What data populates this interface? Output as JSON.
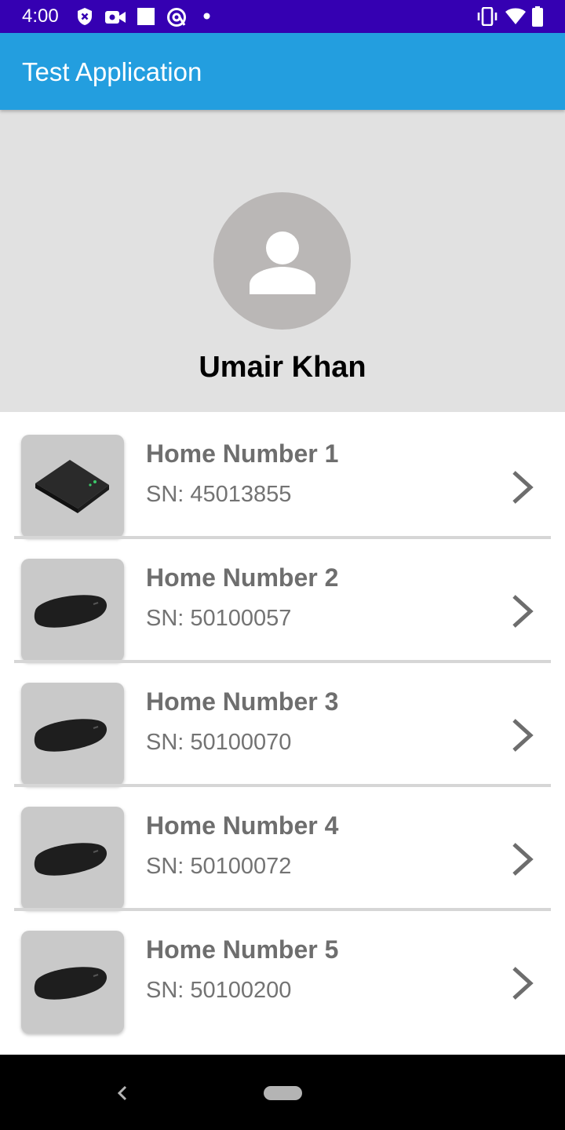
{
  "status_bar": {
    "time": "4:00",
    "left_icons": [
      "shield-icon",
      "camera-icon",
      "square-icon",
      "at-circle-icon",
      "dot-icon"
    ],
    "right_icons": [
      "vibrate-icon",
      "wifi-icon",
      "battery-icon"
    ]
  },
  "app_bar": {
    "title": "Test Application"
  },
  "profile": {
    "name": "Umair Khan",
    "avatar_icon": "person-icon"
  },
  "devices": [
    {
      "name": "Home Number 1",
      "serial": "SN: 45013855"
    },
    {
      "name": "Home Number 2",
      "serial": "SN: 50100057"
    },
    {
      "name": "Home Number 3",
      "serial": "SN: 50100070"
    },
    {
      "name": "Home Number 4",
      "serial": "SN: 50100072"
    },
    {
      "name": "Home Number 5",
      "serial": "SN: 50100200"
    }
  ],
  "colors": {
    "status_bar": "#3500b2",
    "app_bar": "#239edf",
    "profile_bg": "#e1e1e1",
    "avatar_bg": "#bab7b6"
  }
}
